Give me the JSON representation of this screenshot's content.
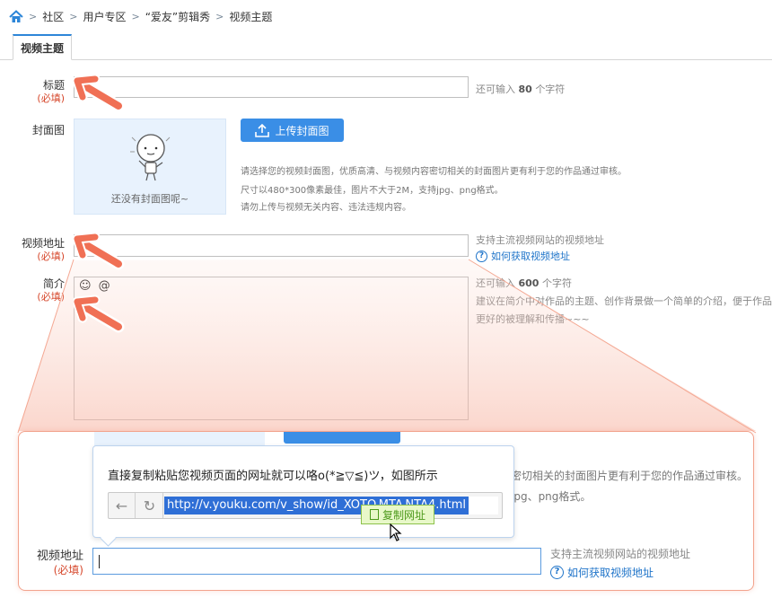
{
  "breadcrumb": {
    "items": [
      "社区",
      "用户专区",
      "“爱友”剪辑秀",
      "视频主题"
    ]
  },
  "tabs": [
    {
      "label": "视频主题",
      "active": true
    }
  ],
  "form": {
    "title": {
      "label": "标题",
      "required": "(必填)",
      "hint_prefix": "还可输入",
      "hint_count": "80",
      "hint_suffix": "个字符"
    },
    "cover": {
      "label": "封面图",
      "placeholder_text": "还没有封面图呢~",
      "upload_label": "上传封面图",
      "desc": [
        "请选择您的视频封面图，优质高清、与视频内容密切相关的封面图片更有利于您的作品通过审核。",
        "尺寸以480*300像素最佳，图片不大于2M，支持jpg、png格式。",
        "请勿上传与视频无关内容、违法违规内容。"
      ]
    },
    "video_url": {
      "label": "视频地址",
      "required": "(必填)",
      "hint": "支持主流视频网站的视频地址",
      "help_link": "如何获取视频地址"
    },
    "intro": {
      "label": "简介",
      "required": "(必填)",
      "emoji_icons": [
        "☺",
        "@"
      ],
      "hint_prefix": "还可输入",
      "hint_count": "600",
      "hint_suffix": "个字符",
      "hint_lines": [
        "建议在简介中对作品的主题、创作背景做一个简单的介绍，便于作品",
        "更好的被理解和传播~~~"
      ]
    }
  },
  "zoom": {
    "bg_texts": [
      "密切相关的封面图片更有利于您的作品通过审核。",
      "jpg、png格式。"
    ],
    "tooltip": {
      "text": "直接复制粘贴您视频页面的网址就可以咯o(*≧▽≦)ツ，如图所示",
      "url": "http://v.youku.com/v_show/id_XOTQ MTA NTA4.html",
      "copy_label": "复制网址"
    },
    "video_url": {
      "label": "视频地址",
      "required": "(必填)",
      "hint": "支持主流视频网站的视频地址",
      "help_link": "如何获取视频地址"
    }
  },
  "colors": {
    "accent": "#3a8ee6",
    "required": "#d6472b",
    "arrow": "#f07055",
    "link": "#1f74c9"
  }
}
